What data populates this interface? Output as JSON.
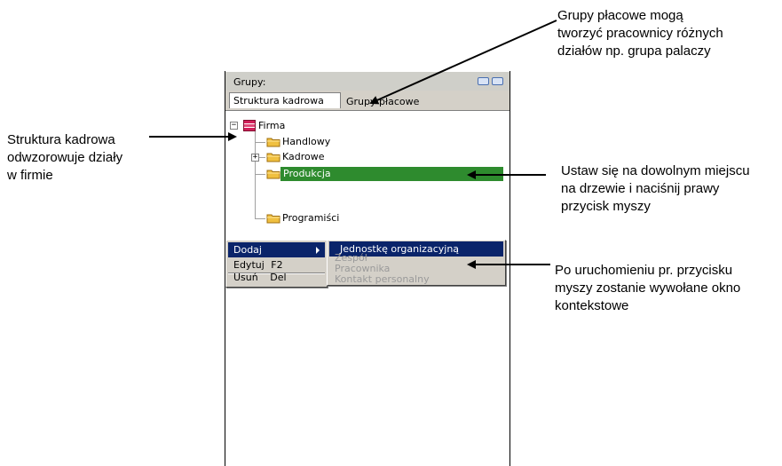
{
  "window": {
    "title": "Grupy:"
  },
  "tabs": [
    {
      "label": "Struktura kadrowa",
      "active": true
    },
    {
      "label": "Grupy płacowe",
      "active": false
    }
  ],
  "tree": {
    "root": "Firma",
    "children": [
      {
        "label": "Handlowy"
      },
      {
        "label": "Kadrowe",
        "expandable": true
      },
      {
        "label": "Produkcja",
        "selected": true
      },
      {
        "label": "Programiści"
      }
    ]
  },
  "context_menu": {
    "items": [
      {
        "label": "Dodaj",
        "has_submenu": true,
        "highlighted": true
      },
      {
        "label": "Edytuj",
        "shortcut": "F2"
      },
      {
        "label": "Usuń",
        "shortcut": "Del"
      }
    ],
    "submenu": [
      {
        "label": "Jednostkę organizacyjną",
        "enabled": true
      },
      {
        "label": "Zespół",
        "enabled": false
      },
      {
        "label": "Pracownika",
        "enabled": false
      },
      {
        "label": "Kontakt personalny",
        "enabled": false
      }
    ]
  },
  "callouts": {
    "grupy_placowe": [
      "Grupy płacowe mogą",
      "tworzyć pracownicy różnych",
      "działów np. grupa palaczy"
    ],
    "struktura": [
      "Struktura kadrowa",
      "odwzorowuje działy",
      "w firmie"
    ],
    "ustaw": [
      "Ustaw się na dowolnym miejscu",
      "na drzewie i naciśnij prawy",
      "przycisk myszy"
    ],
    "okno": [
      "Po uruchomieniu pr. przycisku",
      "myszy zostanie wywołane okno",
      "kontekstowe"
    ]
  },
  "colors": {
    "selection_green": "#2e8b2e",
    "menu_highlight": "#0a246a",
    "folder_yellow": "#f0c040",
    "root_red": "#d0205a"
  }
}
